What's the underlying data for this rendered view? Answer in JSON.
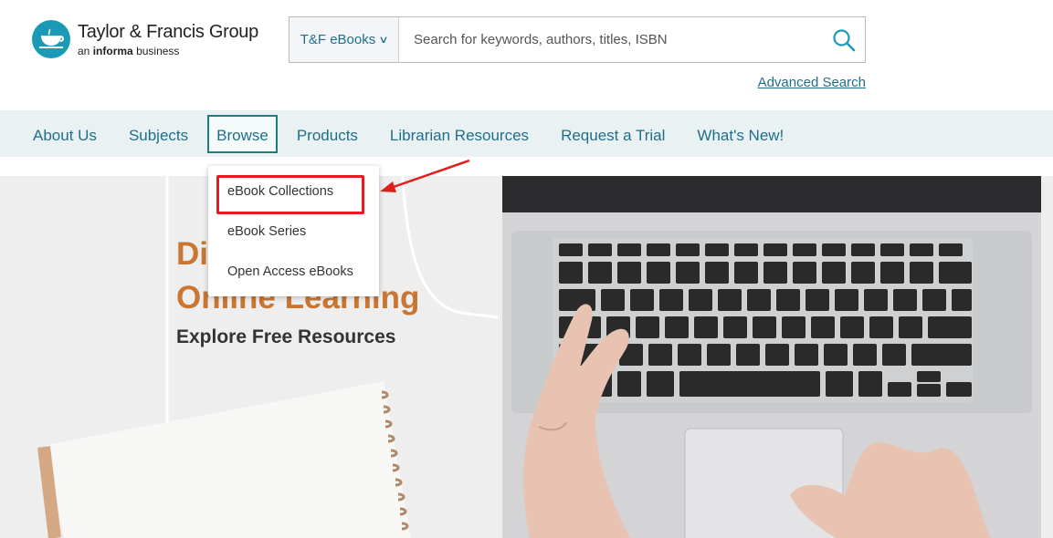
{
  "header": {
    "logo_title": "Taylor & Francis Group",
    "logo_sub_prefix": "an",
    "logo_sub_brand": "informa",
    "logo_sub_suffix": "business",
    "search": {
      "scope_label": "T&F eBooks",
      "placeholder": "Search for keywords, authors, titles, ISBN"
    },
    "advanced_search": "Advanced Search"
  },
  "nav": {
    "items": [
      {
        "label": "About Us"
      },
      {
        "label": "Subjects"
      },
      {
        "label": "Browse"
      },
      {
        "label": "Products"
      },
      {
        "label": "Librarian Resources"
      },
      {
        "label": "Request a Trial"
      },
      {
        "label": "What's New!"
      }
    ]
  },
  "dropdown": {
    "items": [
      {
        "label": "eBook Collections"
      },
      {
        "label": "eBook Series"
      },
      {
        "label": "Open Access eBooks"
      }
    ]
  },
  "hero": {
    "title_line1": "Di",
    "title_line2": "Online Learning",
    "subtitle": "Explore Free Resources"
  },
  "colors": {
    "brand_teal": "#1b9ab8",
    "link_blue": "#1f6f8b",
    "nav_bg": "#e9f1f3",
    "hero_accent": "#c87632",
    "highlight_red": "#e01e1e"
  }
}
